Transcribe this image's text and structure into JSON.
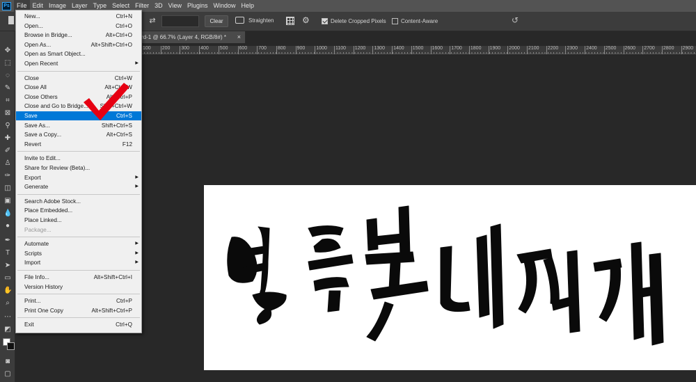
{
  "app": {
    "logo": "Ps"
  },
  "menubar": [
    "File",
    "Edit",
    "Image",
    "Layer",
    "Type",
    "Select",
    "Filter",
    "3D",
    "View",
    "Plugins",
    "Window",
    "Help"
  ],
  "options": {
    "clear_label": "Clear",
    "straighten_label": "Straighten",
    "delete_cropped_label": "Delete Cropped Pixels",
    "delete_cropped_checked": true,
    "content_aware_label": "Content-Aware",
    "content_aware_checked": false
  },
  "tab": {
    "title": "rd-1 @ 66.7% (Layer 4, RGB/8#) *",
    "close": "×"
  },
  "ruler_labels": [
    "100",
    "200",
    "300",
    "400",
    "500",
    "600",
    "700",
    "800",
    "900",
    "1000",
    "1100",
    "1200",
    "1300",
    "1400",
    "1500",
    "1600",
    "1700",
    "1800",
    "1900",
    "2000",
    "2100",
    "2200",
    "2300",
    "2400",
    "2500",
    "2600",
    "2700",
    "2800",
    "2900"
  ],
  "file_menu": [
    {
      "label": "New...",
      "shortcut": "Ctrl+N"
    },
    {
      "label": "Open...",
      "shortcut": "Ctrl+O"
    },
    {
      "label": "Browse in Bridge...",
      "shortcut": "Alt+Ctrl+O"
    },
    {
      "label": "Open As...",
      "shortcut": "Alt+Shift+Ctrl+O"
    },
    {
      "label": "Open as Smart Object...",
      "shortcut": ""
    },
    {
      "label": "Open Recent",
      "shortcut": "",
      "submenu": true
    },
    {
      "separator": true
    },
    {
      "label": "Close",
      "shortcut": "Ctrl+W"
    },
    {
      "label": "Close All",
      "shortcut": "Alt+Ctrl+W"
    },
    {
      "label": "Close Others",
      "shortcut": "Alt+Ctrl+P"
    },
    {
      "label": "Close and Go to Bridge...",
      "shortcut": "Shift+Ctrl+W"
    },
    {
      "label": "Save",
      "shortcut": "Ctrl+S",
      "highlighted": true
    },
    {
      "label": "Save As...",
      "shortcut": "Shift+Ctrl+S"
    },
    {
      "label": "Save a Copy...",
      "shortcut": "Alt+Ctrl+S"
    },
    {
      "label": "Revert",
      "shortcut": "F12"
    },
    {
      "separator": true
    },
    {
      "label": "Invite to Edit...",
      "shortcut": ""
    },
    {
      "label": "Share for Review (Beta)...",
      "shortcut": ""
    },
    {
      "label": "Export",
      "shortcut": "",
      "submenu": true
    },
    {
      "label": "Generate",
      "shortcut": "",
      "submenu": true
    },
    {
      "separator": true
    },
    {
      "label": "Search Adobe Stock...",
      "shortcut": ""
    },
    {
      "label": "Place Embedded...",
      "shortcut": ""
    },
    {
      "label": "Place Linked...",
      "shortcut": ""
    },
    {
      "label": "Package...",
      "shortcut": "",
      "disabled": true
    },
    {
      "separator": true
    },
    {
      "label": "Automate",
      "shortcut": "",
      "submenu": true
    },
    {
      "label": "Scripts",
      "shortcut": "",
      "submenu": true
    },
    {
      "label": "Import",
      "shortcut": "",
      "submenu": true
    },
    {
      "separator": true
    },
    {
      "label": "File Info...",
      "shortcut": "Alt+Shift+Ctrl+I"
    },
    {
      "label": "Version History",
      "shortcut": ""
    },
    {
      "separator": true
    },
    {
      "label": "Print...",
      "shortcut": "Ctrl+P"
    },
    {
      "label": "Print One Copy",
      "shortcut": "Alt+Shift+Ctrl+P"
    },
    {
      "separator": true
    },
    {
      "label": "Exit",
      "shortcut": "Ctrl+Q"
    }
  ],
  "colors": {
    "menu_highlight": "#0078d7",
    "annotation_check": "#e60012"
  }
}
